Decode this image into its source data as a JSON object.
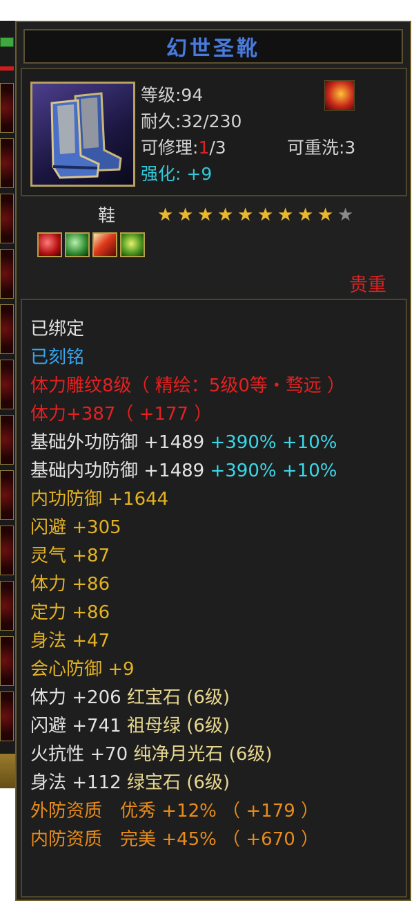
{
  "item": {
    "name": "幻世圣靴",
    "level_label": "等级:94",
    "durability_label": "耐久:32/230",
    "repair_prefix": "可修理:",
    "repair_current": "1",
    "repair_suffix": "/3",
    "rewash_label": "可重洗:3",
    "enhance_label": "强化: +9",
    "type": "鞋",
    "rarity": "贵重",
    "icon": "boot-icon",
    "corner_icon": "fire-emblem-icon"
  },
  "stars": {
    "filled": 9,
    "total": 10
  },
  "gems": [
    "red-gem-icon",
    "green-gem-icon",
    "fire-gem-icon",
    "lime-gem-icon"
  ],
  "details": {
    "bound": "已绑定",
    "engraved": "已刻铭",
    "carving": "体力雕纹8级（ 精绘：5级0等・骛远 ）",
    "stamina_bonus": "体力+387（ +177 ）",
    "base_outer_def": {
      "label": "基础外功防御 +1489",
      "pct1": "+390%",
      "pct2": "+10%"
    },
    "base_inner_def": {
      "label": "基础内功防御 +1489",
      "pct1": "+390%",
      "pct2": "+10%"
    },
    "inner_def": "内功防御 +1644",
    "dodge": "闪避 +305",
    "spirit": "灵气 +87",
    "stamina": "体力 +86",
    "focus": "定力 +86",
    "agility": "身法 +47",
    "crit_def": "会心防御 +9",
    "gem_lines": [
      {
        "stat": "体力 +206",
        "gem": "红宝石 (6级)"
      },
      {
        "stat": "闪避 +741",
        "gem": "祖母绿 (6级)"
      },
      {
        "stat": "火抗性 +70",
        "gem": "纯净月光石 (6级)"
      },
      {
        "stat": "身法 +112",
        "gem": "绿宝石 (6级)"
      }
    ],
    "quality_outer": "外防资质　优秀 +12% （ +179 ）",
    "quality_inner": "内防资质　完美 +45% （ +670 ）"
  },
  "colors": {
    "title": "#4b7bd8",
    "rarity": "#e02020",
    "bound": "#e2e2e2",
    "engraved": "#36a6f0",
    "stat_yellow": "#e4b222",
    "quality_orange": "#e88c1c"
  }
}
